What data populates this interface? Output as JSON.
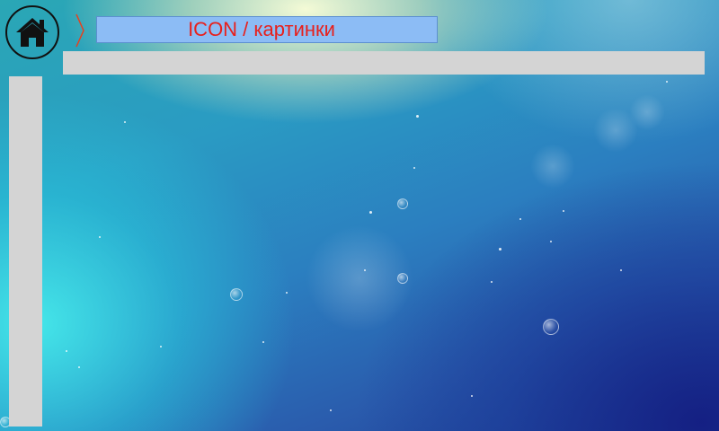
{
  "header": {
    "home_icon": "home-icon",
    "separator_icon": "chevron-right-icon",
    "separator_color": "#e8401c",
    "title": "ICON / картинки",
    "title_color": "#e8201c",
    "title_background": "#8cbcf5"
  },
  "panels": {
    "top_bar_color": "#d4d4d4",
    "side_bar_color": "#d4d4d4"
  }
}
